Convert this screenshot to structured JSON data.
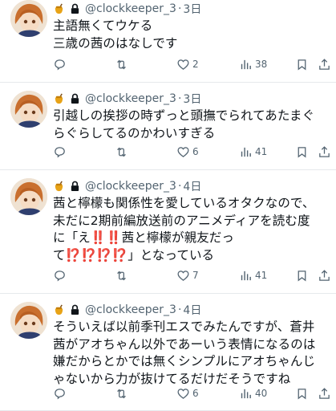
{
  "tweets": [
    {
      "handle": "@clockkeeper_3",
      "separator": "·",
      "date": "3日",
      "lines": [
        "主語無くてウケる",
        "三歳の茜のはなしです"
      ],
      "likes": "2",
      "views": "38"
    },
    {
      "handle": "@clockkeeper_3",
      "separator": "·",
      "date": "3日",
      "lines": [
        "引越しの挨拶の時ずっと頭撫でられてあたまぐ",
        "らぐらしてるのかわいすぎる"
      ],
      "likes": "6",
      "views": "41"
    },
    {
      "handle": "@clockkeeper_3",
      "separator": "·",
      "date": "4日",
      "lines": [
        "茜と檸檬も関係性を愛しているオタクなので、",
        "未だに2期前編放送前のアニメディアを読む度",
        "に「え‼️‼️茜と檸檬が親友だっ",
        "て⁉️⁉️⁉️⁉️」となっている"
      ],
      "likes": "7",
      "views": "41"
    },
    {
      "handle": "@clockkeeper_3",
      "separator": "·",
      "date": "4日",
      "lines": [
        "そういえば以前季刊エスでみたんですが、蒼井",
        "茜がアオちゃん以外であーいう表情になるのは",
        "嫌だからとかでは無くシンプルにアオちゃんじ",
        "ゃないから力が抜けてるだけだそうですね"
      ],
      "likes": "6",
      "views": "40"
    }
  ],
  "icons": {
    "badge": "honey-pot-icon",
    "lock": "lock-icon",
    "reply": "reply-icon",
    "retweet": "retweet-icon",
    "like": "heart-icon",
    "views": "views-icon",
    "bookmark": "bookmark-icon",
    "share": "share-icon"
  },
  "colors": {
    "text": "#0f1419",
    "muted": "#536471",
    "divider": "#e6e9ec"
  }
}
